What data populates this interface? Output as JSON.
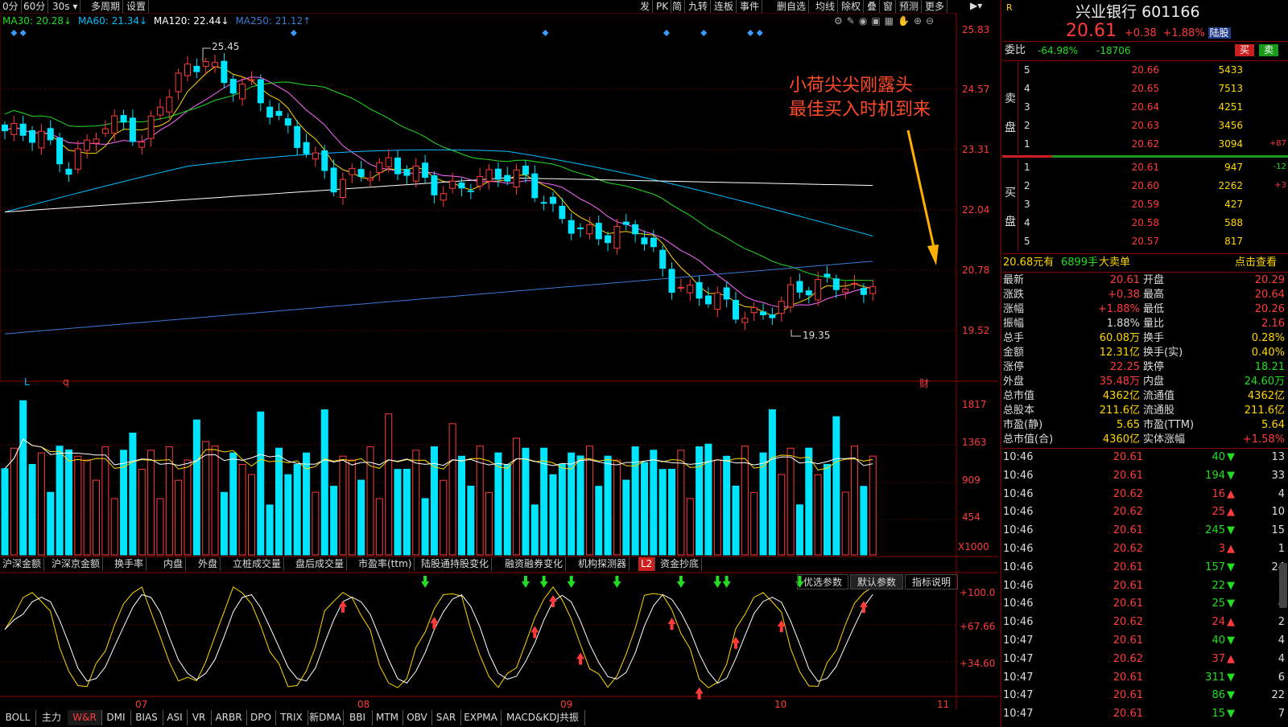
{
  "toolbar": {
    "left_items": [
      "0分",
      "60分",
      "30s",
      "多周期",
      "设置"
    ],
    "right_items": [
      "发",
      "PK",
      "简",
      "九转",
      "连板",
      "事件",
      "删自选",
      "均线",
      "除权",
      "叠",
      "窗",
      "预测",
      "更多"
    ]
  },
  "ma_legend": [
    {
      "label": "MA30: 20.28↓",
      "color": "#22dd22"
    },
    {
      "label": "MA60: 21.34↓",
      "color": "#00bfff"
    },
    {
      "label": "MA120: 22.44↓",
      "color": "#ffffff"
    },
    {
      "label": "MA250: 21.12↑",
      "color": "#3a7bd5"
    }
  ],
  "price_axis": [
    "25.83",
    "24.57",
    "23.31",
    "22.04",
    "20.78",
    "19.52"
  ],
  "price_annotations": {
    "high": "25.45",
    "low": "19.35"
  },
  "annotation": {
    "line1": "小荷尖尖刚露头",
    "line2": "最佳买入时机到来"
  },
  "markers": {
    "l": "L",
    "q": "q",
    "cai": "财"
  },
  "volume_axis": [
    "1817",
    "1363",
    "909",
    "454",
    "X1000"
  ],
  "indicator_tabs": [
    "沪深金额",
    "沪深京金额",
    "换手率",
    "内盘",
    "外盘",
    "立桩成交量",
    "盘后成交量",
    "市盈率(ttm)",
    "陆股通持股变化",
    "融资融券变化",
    "机构探测器",
    "L2",
    "资金抄底"
  ],
  "param_buttons": [
    "优选参数",
    "默认参数",
    "指标说明"
  ],
  "wr_axis": [
    "+100.0",
    "+67.66",
    "+34.60"
  ],
  "date_labels": [
    "07",
    "08",
    "09",
    "10",
    "11"
  ],
  "bottom_tabs": [
    "BOLL",
    "主力",
    "W&R",
    "DMI",
    "BIAS",
    "ASI",
    "VR",
    "ARBR",
    "DPO",
    "TRIX",
    "新DMA",
    "BBI",
    "MTM",
    "OBV",
    "SAR",
    "EXPMA",
    "MACD&KDJ共振"
  ],
  "active_bottom_tab": "W&R",
  "stock": {
    "name": "兴业银行",
    "code": "601166",
    "r_mark": "R",
    "price": "20.61",
    "change": "+0.38",
    "change_pct": "+1.88%",
    "tag": "陆股",
    "buy_btn": "买",
    "sell_btn": "卖"
  },
  "order_ratio": {
    "label": "委比",
    "pct": "-64.98%",
    "diff": "-18706"
  },
  "sell_label": [
    "卖",
    "盘"
  ],
  "buy_label": [
    "买",
    "盘"
  ],
  "sell_orders": [
    {
      "level": "5",
      "price": "20.66",
      "vol": "5433",
      "chg": ""
    },
    {
      "level": "4",
      "price": "20.65",
      "vol": "7513",
      "chg": ""
    },
    {
      "level": "3",
      "price": "20.64",
      "vol": "4251",
      "chg": ""
    },
    {
      "level": "2",
      "price": "20.63",
      "vol": "3456",
      "chg": ""
    },
    {
      "level": "1",
      "price": "20.62",
      "vol": "3094",
      "chg": "+87"
    }
  ],
  "buy_orders": [
    {
      "level": "1",
      "price": "20.61",
      "vol": "947",
      "chg": "-12"
    },
    {
      "level": "2",
      "price": "20.60",
      "vol": "2262",
      "chg": "+3"
    },
    {
      "level": "3",
      "price": "20.59",
      "vol": "427",
      "chg": ""
    },
    {
      "level": "4",
      "price": "20.58",
      "vol": "588",
      "chg": ""
    },
    {
      "level": "5",
      "price": "20.57",
      "vol": "817",
      "chg": ""
    }
  ],
  "big_order": {
    "text1": "20.68元有",
    "text2": "6899手",
    "text3": "大卖单",
    "link": "点击查看"
  },
  "stats": [
    {
      "l1": "最新",
      "v1": "20.61",
      "c1": "red",
      "l2": "开盘",
      "v2": "20.29",
      "c2": "red"
    },
    {
      "l1": "涨跌",
      "v1": "+0.38",
      "c1": "red",
      "l2": "最高",
      "v2": "20.64",
      "c2": "red"
    },
    {
      "l1": "涨幅",
      "v1": "+1.88%",
      "c1": "red",
      "l2": "最低",
      "v2": "20.26",
      "c2": "red"
    },
    {
      "l1": "振幅",
      "v1": "1.88%",
      "c1": "white",
      "l2": "量比",
      "v2": "2.16",
      "c2": "red"
    },
    {
      "l1": "总手",
      "v1": "60.08万",
      "c1": "yellow",
      "l2": "换手",
      "v2": "0.28%",
      "c2": "yellow"
    },
    {
      "l1": "金额",
      "v1": "12.31亿",
      "c1": "yellow",
      "l2": "换手(实)",
      "v2": "0.40%",
      "c2": "yellow"
    },
    {
      "l1": "涨停",
      "v1": "22.25",
      "c1": "red",
      "l2": "跌停",
      "v2": "18.21",
      "c2": "green"
    },
    {
      "l1": "外盘",
      "v1": "35.48万",
      "c1": "red",
      "l2": "内盘",
      "v2": "24.60万",
      "c2": "green"
    },
    {
      "l1": "总市值",
      "v1": "4362亿",
      "c1": "yellow",
      "l2": "流通值",
      "v2": "4362亿",
      "c2": "yellow"
    },
    {
      "l1": "总股本",
      "v1": "211.6亿",
      "c1": "yellow",
      "l2": "流通股",
      "v2": "211.6亿",
      "c2": "yellow"
    },
    {
      "l1": "市盈(静)",
      "v1": "5.65",
      "c1": "yellow",
      "l2": "市盈(TTM)",
      "v2": "5.64",
      "c2": "yellow"
    },
    {
      "l1": "总市值(合)",
      "v1": "4360亿",
      "c1": "yellow",
      "l2": "实体涨幅",
      "v2": "+1.58%",
      "c2": "red"
    }
  ],
  "ticks": [
    {
      "time": "10:46",
      "price": "20.61",
      "vol": "40",
      "dir": "down",
      "n": "13"
    },
    {
      "time": "10:46",
      "price": "20.61",
      "vol": "194",
      "dir": "down",
      "n": "33"
    },
    {
      "time": "10:46",
      "price": "20.62",
      "vol": "16",
      "dir": "up",
      "n": "4"
    },
    {
      "time": "10:46",
      "price": "20.62",
      "vol": "25",
      "dir": "up",
      "n": "10"
    },
    {
      "time": "10:46",
      "price": "20.61",
      "vol": "245",
      "dir": "down",
      "n": "15"
    },
    {
      "time": "10:46",
      "price": "20.62",
      "vol": "3",
      "dir": "up",
      "n": "1"
    },
    {
      "time": "10:46",
      "price": "20.61",
      "vol": "157",
      "dir": "down",
      "n": "24"
    },
    {
      "time": "10:46",
      "price": "20.61",
      "vol": "22",
      "dir": "down",
      "n": "7"
    },
    {
      "time": "10:46",
      "price": "20.61",
      "vol": "25",
      "dir": "down",
      "n": "4"
    },
    {
      "time": "10:46",
      "price": "20.62",
      "vol": "24",
      "dir": "up",
      "n": "2"
    },
    {
      "time": "10:47",
      "price": "20.61",
      "vol": "40",
      "dir": "down",
      "n": "4"
    },
    {
      "time": "10:47",
      "price": "20.62",
      "vol": "37",
      "dir": "up",
      "n": "4"
    },
    {
      "time": "10:47",
      "price": "20.61",
      "vol": "311",
      "dir": "down",
      "n": "6"
    },
    {
      "time": "10:47",
      "price": "20.61",
      "vol": "86",
      "dir": "down",
      "n": "22"
    },
    {
      "time": "10:47",
      "price": "20.61",
      "vol": "15",
      "dir": "down",
      "n": "7"
    }
  ],
  "colors": {
    "up": "#ff3b3b",
    "down": "#00e5ff",
    "ma5": "#ffffff",
    "ma10": "#ffd700",
    "ma20": "#ff66ff",
    "ma30": "#22dd22",
    "ma60": "#00bfff",
    "ma120": "#ffffff",
    "ma250": "#3a7bd5"
  }
}
